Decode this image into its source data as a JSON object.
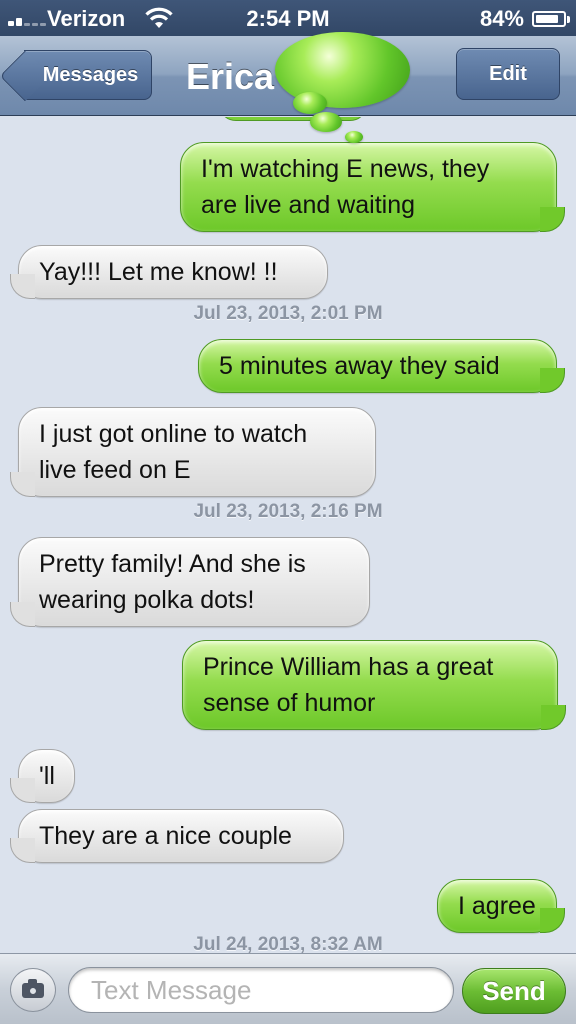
{
  "status_bar": {
    "carrier": "Verizon",
    "time": "2:54 PM",
    "battery_percent": "84%",
    "battery_level": 0.84,
    "signal_bars": 2
  },
  "nav_bar": {
    "back_label": "Messages",
    "title": "Erica",
    "edit_label": "Edit"
  },
  "sticker": {
    "icon": "green-thought-bubble-icon"
  },
  "messages": [
    {
      "direction": "sent",
      "lines": [
        "I'm watching E news, they",
        "are live and waiting"
      ]
    },
    {
      "direction": "received",
      "lines": [
        "Yay!!! Let me know! !!"
      ]
    },
    {
      "type": "timestamp",
      "text": "Jul 23, 2013, 2:01 PM"
    },
    {
      "direction": "sent",
      "lines": [
        "5 minutes away they said"
      ]
    },
    {
      "direction": "received",
      "lines": [
        "I just got online to watch",
        "live feed on E"
      ]
    },
    {
      "type": "timestamp",
      "text": "Jul 23, 2013, 2:16 PM"
    },
    {
      "direction": "received",
      "lines": [
        "Pretty family! And she is",
        "wearing polka dots!"
      ]
    },
    {
      "direction": "sent",
      "lines": [
        "Prince William has a great",
        "sense of humor"
      ]
    },
    {
      "direction": "received",
      "lines": [
        "'ll"
      ]
    },
    {
      "direction": "received",
      "lines": [
        "They are a nice couple"
      ]
    },
    {
      "direction": "sent",
      "lines": [
        "I agree"
      ]
    },
    {
      "type": "timestamp",
      "text": "Jul 24, 2013, 8:32 AM"
    }
  ],
  "input_bar": {
    "placeholder": "Text Message",
    "value": "",
    "send_label": "Send",
    "camera_icon": "camera-icon"
  },
  "colors": {
    "sent_bubble": "#7ccf3a",
    "received_bubble": "#e6e6e6",
    "background": "#dbe2ed",
    "nav_bar": "#7c94b4"
  }
}
